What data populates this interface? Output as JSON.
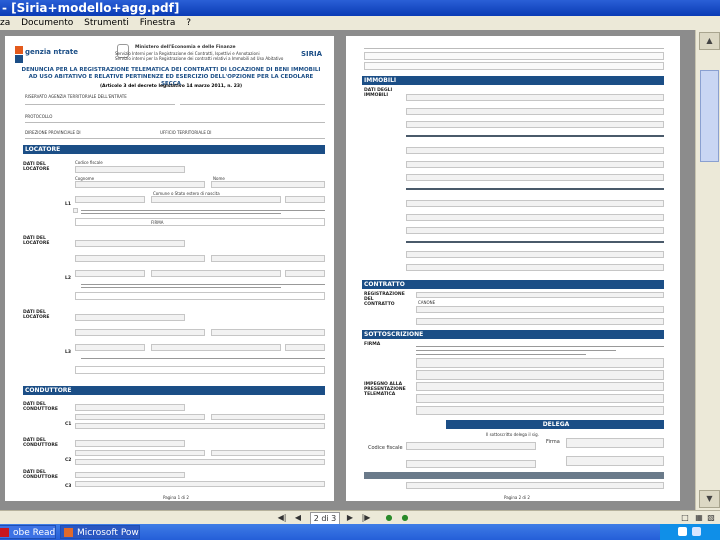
{
  "window": {
    "title": "- [Siria+modello+agg.pdf]"
  },
  "menu": [
    "za",
    "Documento",
    "Strumenti",
    "Finestra",
    "?"
  ],
  "page1": {
    "logo": "genzia ntrate",
    "ministry": "Ministero dell'Economia e delle Finanze",
    "header_line1": "Servizio Interni per la Registrazione dei Contratti, Ispettivi e Annotazioni",
    "header_line2": "Servizio interni per la Registrazione dei contratti relativi a Immobili ad Uso Abitativo",
    "product": "SIRIA",
    "heading": "DENUNCIA PER LA REGISTRAZIONE TELEMATICA DEI CONTRATTI DI LOCAZIONE DI BENI IMMOBILI AD USO ABITATIVO E RELATIVE PERTINENZE ED ESERCIZIO DELL'OPZIONE PER LA CEDOLARE SECCA",
    "subheading": "(Articolo 3 del decreto legislativo 14 marzo 2011, n. 23)",
    "top_fields": [
      "RISERVATO AGENZIA TERRITORIALE DELL'ENTRATE",
      "PROTOCOLLO",
      "DIREZIONE PROVINCIALE DI",
      "UFFICIO TERRITORIALE DI"
    ],
    "sections": {
      "locatore": "LOCATORE",
      "conduttore": "CONDUTTORE"
    },
    "subjects": [
      {
        "label": "DATI DEL LOCATORE",
        "num": "L1"
      },
      {
        "label": "DATI DEL LOCATORE",
        "num": "L2"
      },
      {
        "label": "DATI DEL LOCATORE",
        "num": "L3"
      },
      {
        "label": "DATI DEL CONDUTTORE",
        "num": "C1"
      },
      {
        "label": "DATI DEL CONDUTTORE",
        "num": "C2"
      },
      {
        "label": "DATI DEL CONDUTTORE",
        "num": "C3"
      }
    ],
    "field_labels": [
      "Codice fiscale",
      "Cognome",
      "Nome",
      "Comune o Stato estero di nascita",
      "Provincia (sigla)",
      "FIRMA"
    ],
    "page_label": "Pagina 1 di 2"
  },
  "page2": {
    "sections": {
      "immobili": "IMMOBILI",
      "contratto": "CONTRATTO",
      "sottoscrizione": "SOTTOSCRIZIONE",
      "delega": "DELEGA"
    },
    "labels": {
      "dati_immobili": "DATI DEGLI IMMOBILI",
      "reg_contratto": "REGISTRAZIONE DEL CONTRATTO",
      "firma": "FIRMA",
      "impegno": "IMPEGNO ALLA PRESENTAZIONE TELEMATICA",
      "delega_text": "Il sottoscritto delega il sig.",
      "codice_fiscale": "Codice fiscale",
      "firma_field": "Firma",
      "canone": "CANONE"
    },
    "page_label": "Pagina 2 di 2"
  },
  "navigation": {
    "page_indicator": "2 di 3"
  },
  "taskbar": {
    "items": [
      "obe Reade...",
      "Microsoft Pow..."
    ]
  }
}
